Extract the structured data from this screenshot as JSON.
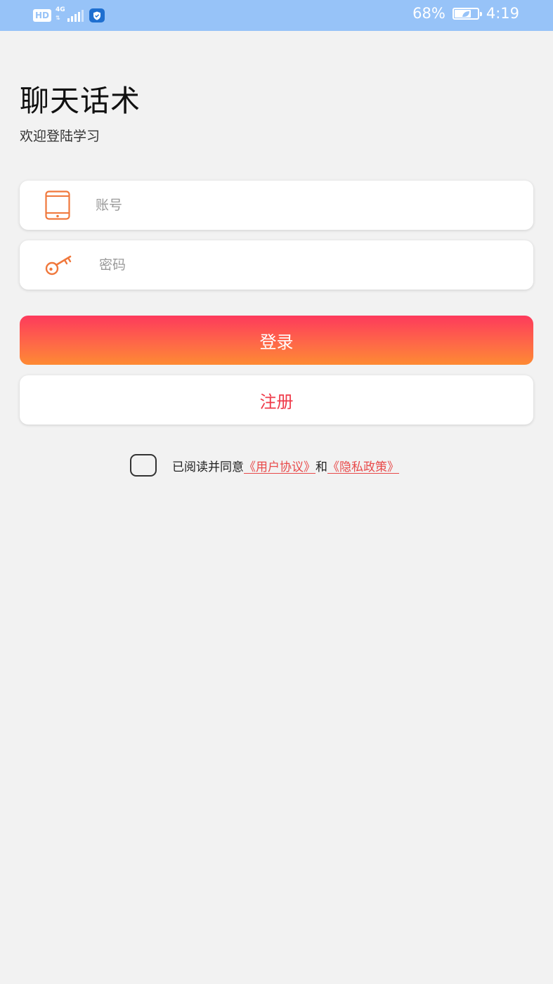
{
  "status_bar": {
    "hd_label": "HD",
    "network_label": "4G",
    "battery_percent": "68%",
    "battery_level": 0.68,
    "time": "4:19",
    "colors": {
      "background": "#97c3f8",
      "foreground": "#ffffff",
      "shield": "#1f6fd0"
    }
  },
  "header": {
    "title": "聊天话术",
    "subtitle": "欢迎登陆学习"
  },
  "form": {
    "account": {
      "placeholder": "账号",
      "value": "",
      "icon": "tablet-icon"
    },
    "password": {
      "placeholder": "密码",
      "value": "",
      "icon": "key-icon"
    }
  },
  "buttons": {
    "login_label": "登录",
    "register_label": "注册"
  },
  "agreement": {
    "checked": false,
    "prefix": "已阅读并同意",
    "user_agreement": "《用户协议》",
    "and": "和",
    "privacy_policy": "《隐私政策》"
  },
  "colors": {
    "accent": "#fd3a5c",
    "accent_end": "#fe8a33",
    "icon": "#f0783c",
    "link": "#e84a4a",
    "page_background": "#f2f2f2"
  }
}
